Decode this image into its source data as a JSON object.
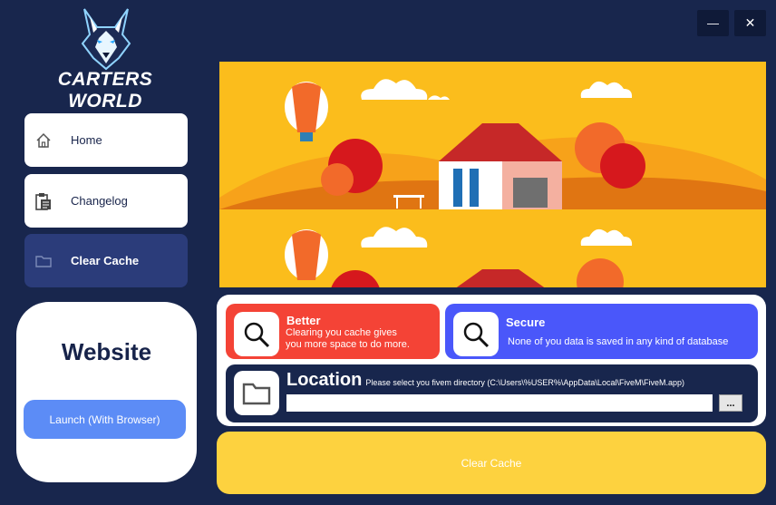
{
  "window": {
    "minimize_glyph": "—",
    "close_glyph": "✕"
  },
  "brand": {
    "name": "CARTERS WORLD",
    "logo_icon": "wolf-logo"
  },
  "sidebar": {
    "items": [
      {
        "label": "Home",
        "icon": "home-icon"
      },
      {
        "label": "Changelog",
        "icon": "clipboard-icon"
      },
      {
        "label": "Clear Cache",
        "icon": "folder-icon"
      }
    ]
  },
  "website": {
    "title": "Website",
    "button_label": "Launch (With Browser)"
  },
  "cards": {
    "better": {
      "title": "Better",
      "text_line1": "Clearing you cache gives",
      "text_line2": "you more space to do more.",
      "color": "#f44336"
    },
    "secure": {
      "title": "Secure",
      "text": "None of you data is saved in any kind of database",
      "color": "#4a57fa"
    },
    "location": {
      "title": "Location",
      "hint": "Please select you fivem directory (C:\\Users\\%USER%\\AppData\\Local\\FiveM\\FiveM.app)",
      "value": "",
      "browse_label": "...",
      "color": "#18264d"
    }
  },
  "clear_button": {
    "label": "Clear Cache",
    "color": "#fdd23f"
  },
  "colors": {
    "background": "#18264d",
    "nav_active": "#2b3c7a",
    "launch_button": "#5c8cf6",
    "banner_bg": "#fbbd1c"
  }
}
